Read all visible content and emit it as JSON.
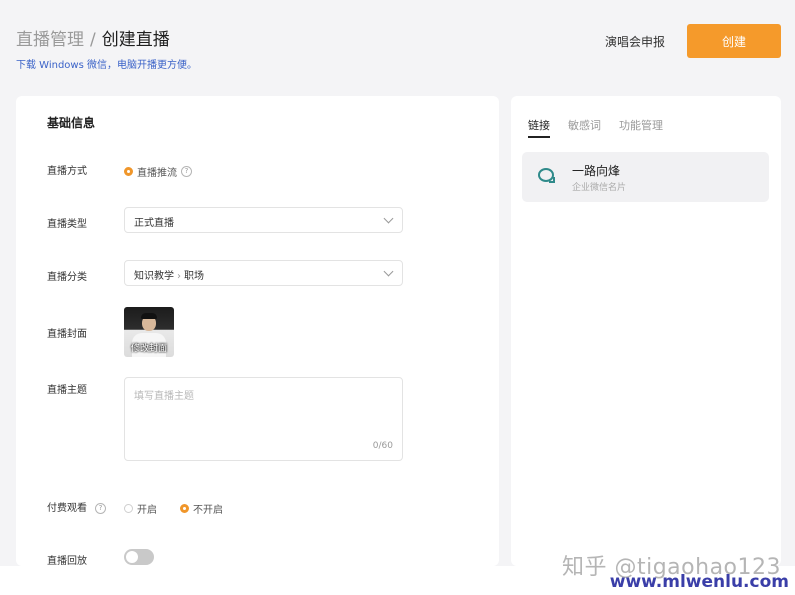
{
  "header": {
    "breadcrumb_parent": "直播管理",
    "breadcrumb_sep": "/",
    "breadcrumb_current": "创建直播",
    "subtitle": "下载 Windows 微信，电脑开播更方便。",
    "report_link": "演唱会申报",
    "create_button": "创建"
  },
  "form": {
    "section_title": "基础信息",
    "mode": {
      "label": "直播方式",
      "option": "直播推流",
      "help_icon": "?"
    },
    "type": {
      "label": "直播类型",
      "value": "正式直播"
    },
    "category": {
      "label": "直播分类",
      "value_main": "知识教学",
      "sep": "›",
      "value_sub": "职场"
    },
    "cover": {
      "label": "直播封面",
      "overlay_text": "修改封面"
    },
    "topic": {
      "label": "直播主题",
      "placeholder": "填写直播主题",
      "count": "0/60"
    },
    "paid": {
      "label": "付费观看",
      "help_icon": "?",
      "option_on": "开启",
      "option_off": "不开启",
      "selected": "不开启"
    },
    "replay": {
      "label": "直播回放",
      "enabled": false
    }
  },
  "sidebar": {
    "tabs": [
      {
        "label": "链接",
        "active": true
      },
      {
        "label": "敏感词",
        "active": false
      },
      {
        "label": "功能管理",
        "active": false
      }
    ],
    "contact": {
      "name": "一路向烽",
      "subtitle": "企业微信名片"
    }
  },
  "watermark": {
    "line1": "知乎 @tigaohao123",
    "line2": "www.mlwenlu.com"
  },
  "colors": {
    "accent": "#f59a2b",
    "subtitle_link": "#3a62c8",
    "chat_icon": "#2f8a8a"
  }
}
